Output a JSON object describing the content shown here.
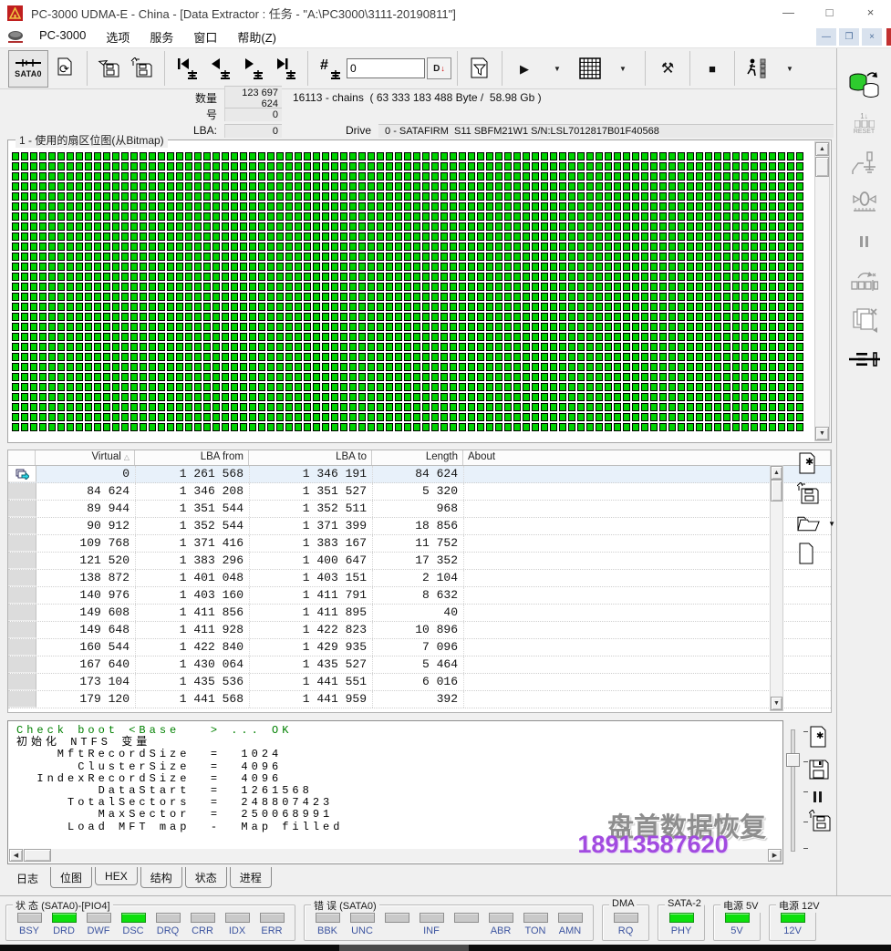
{
  "window": {
    "title": "PC-3000 UDMA-E - China - [Data Extractor : 任务 - \"A:\\PC3000\\3111-20190811\"]",
    "menu": [
      "PC-3000",
      "选项",
      "服务",
      "窗口",
      "帮助(Z)"
    ]
  },
  "icons": {
    "minimize": "—",
    "maximize": "□",
    "close": "×",
    "mdi_minimize": "—",
    "mdi_restore": "❐",
    "mdi_close": "×",
    "play": "▶",
    "stop": "■",
    "dropdown": "▼",
    "tools": "⚒",
    "hash": "#",
    "refresh": "⟳",
    "sort_asc": "△",
    "scroll_up": "▲",
    "scroll_down": "▼",
    "scroll_left": "◀",
    "scroll_right": "▶",
    "d_button": "D",
    "d_arrow": "↓"
  },
  "toolbar": {
    "device_label": "SATA0",
    "sector_input": "0"
  },
  "info": {
    "count_label": "数量",
    "count_value": "123 697 624",
    "chains_text": "16113 - chains  ( 63 333 183 488 Byte /  58.98 Gb )",
    "num_label": "号",
    "num_value": "0",
    "lba_label": "LBA:",
    "lba_value": "0",
    "drive_label": "Drive",
    "drive_value": "0 - SATAFIRM  S11 SBFM21W1 S/N:LSL7012817B01F40568"
  },
  "bitmap": {
    "title": "1 - 使用的扇区位图(从Bitmap)",
    "rows": 28,
    "cols": 87,
    "on_color": "#00d300"
  },
  "table": {
    "columns": [
      "Virtual",
      "LBA from",
      "LBA to",
      "Length",
      "About"
    ],
    "rows": [
      [
        "0",
        "1 261 568",
        "1 346 191",
        "84 624",
        ""
      ],
      [
        "84 624",
        "1 346 208",
        "1 351 527",
        "5 320",
        ""
      ],
      [
        "89 944",
        "1 351 544",
        "1 352 511",
        "968",
        ""
      ],
      [
        "90 912",
        "1 352 544",
        "1 371 399",
        "18 856",
        ""
      ],
      [
        "109 768",
        "1 371 416",
        "1 383 167",
        "11 752",
        ""
      ],
      [
        "121 520",
        "1 383 296",
        "1 400 647",
        "17 352",
        ""
      ],
      [
        "138 872",
        "1 401 048",
        "1 403 151",
        "2 104",
        ""
      ],
      [
        "140 976",
        "1 403 160",
        "1 411 791",
        "8 632",
        ""
      ],
      [
        "149 608",
        "1 411 856",
        "1 411 895",
        "40",
        ""
      ],
      [
        "149 648",
        "1 411 928",
        "1 422 823",
        "10 896",
        ""
      ],
      [
        "160 544",
        "1 422 840",
        "1 429 935",
        "7 096",
        ""
      ],
      [
        "167 640",
        "1 430 064",
        "1 435 527",
        "5 464",
        ""
      ],
      [
        "173 104",
        "1 435 536",
        "1 441 551",
        "6 016",
        ""
      ],
      [
        "179 120",
        "1 441 568",
        "1 441 959",
        "392",
        ""
      ]
    ],
    "selected_row": 0
  },
  "log": {
    "lines": [
      {
        "text": "Check boot <Base   > ... OK",
        "color": "#008000"
      },
      {
        "text": "初始化 NTFS 变量",
        "color": "#000000"
      },
      {
        "text": "    MftRecordSize  =  1024",
        "color": "#000000"
      },
      {
        "text": "      ClusterSize  =  4096",
        "color": "#000000"
      },
      {
        "text": "  IndexRecordSize  =  4096",
        "color": "#000000"
      },
      {
        "text": "        DataStart  =  1261568",
        "color": "#000000"
      },
      {
        "text": "     TotalSectors  =  248807423",
        "color": "#000000"
      },
      {
        "text": "        MaxSector  =  250068991",
        "color": "#000000"
      },
      {
        "text": "     Load MFT map  -  Map filled",
        "color": "#000000"
      }
    ]
  },
  "watermark": {
    "line1": "盘首数据恢复",
    "line2": "18913587620",
    "color2": "#a24be0"
  },
  "tabs": {
    "items": [
      "日志",
      "位图",
      "HEX",
      "结构",
      "状态",
      "进程"
    ],
    "active": 0
  },
  "status": {
    "groups": [
      {
        "title": "状 态 (SATA0)-[PIO4]",
        "leds": [
          {
            "label": "BSY",
            "on": false
          },
          {
            "label": "DRD",
            "on": true
          },
          {
            "label": "DWF",
            "on": false
          },
          {
            "label": "DSC",
            "on": true
          },
          {
            "label": "DRQ",
            "on": false
          },
          {
            "label": "CRR",
            "on": false
          },
          {
            "label": "IDX",
            "on": false
          },
          {
            "label": "ERR",
            "on": false
          }
        ]
      },
      {
        "title": "错 误 (SATA0)",
        "leds": [
          {
            "label": "BBK",
            "on": false
          },
          {
            "label": "UNC",
            "on": false
          },
          {
            "label": "",
            "on": false
          },
          {
            "label": "INF",
            "on": false
          },
          {
            "label": "",
            "on": false
          },
          {
            "label": "ABR",
            "on": false
          },
          {
            "label": "TON",
            "on": false
          },
          {
            "label": "AMN",
            "on": false
          }
        ]
      },
      {
        "title": "DMA",
        "leds": [
          {
            "label": "RQ",
            "on": false
          }
        ]
      },
      {
        "title": "SATA-2",
        "leds": [
          {
            "label": "PHY",
            "on": true
          }
        ]
      },
      {
        "title": "电源 5V",
        "leds": [
          {
            "label": "5V",
            "on": true
          }
        ]
      },
      {
        "title": "电源 12V",
        "leds": [
          {
            "label": "12V",
            "on": true
          }
        ]
      }
    ]
  }
}
